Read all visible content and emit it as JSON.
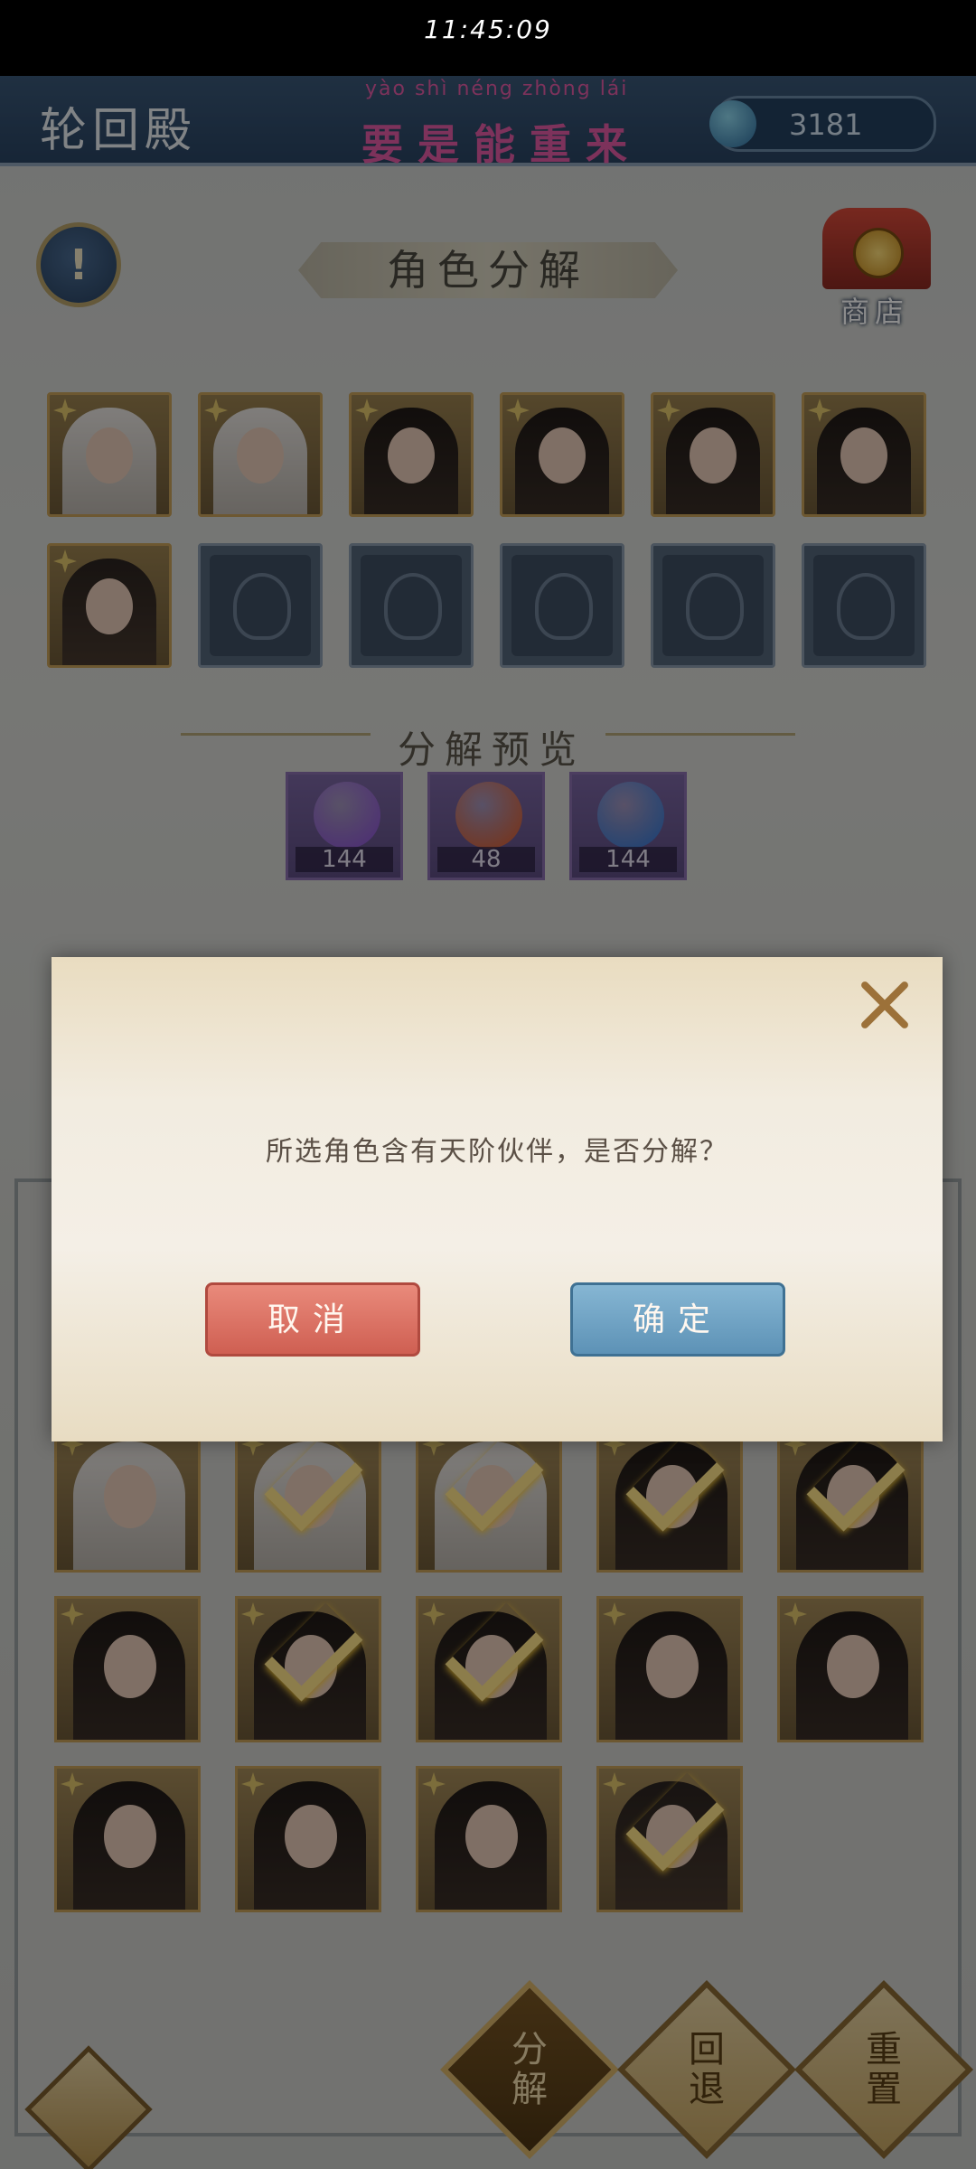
{
  "status_bar": {
    "time": "11:45:09"
  },
  "header": {
    "scene_title": "轮回殿",
    "slogan_pinyin": "yào shì néng zhòng lái",
    "slogan": "要是能重来",
    "currency_value": "3181"
  },
  "section": {
    "title": "角色分解",
    "shop_label": "商店"
  },
  "selected_slots": [
    {
      "type": "character",
      "look": "white"
    },
    {
      "type": "character",
      "look": "white"
    },
    {
      "type": "character",
      "look": "dark"
    },
    {
      "type": "character",
      "look": "dark"
    },
    {
      "type": "character",
      "look": "dark"
    },
    {
      "type": "character",
      "look": "dark"
    },
    {
      "type": "character",
      "look": "man"
    },
    {
      "type": "empty"
    },
    {
      "type": "empty"
    },
    {
      "type": "empty"
    },
    {
      "type": "empty"
    },
    {
      "type": "empty"
    }
  ],
  "preview": {
    "title": "分解预览",
    "items": [
      {
        "name": "purple-essence",
        "count": "144",
        "color": "#8c4fd8"
      },
      {
        "name": "red-essence",
        "count": "48",
        "color": "#e05a24"
      },
      {
        "name": "blue-essence",
        "count": "144",
        "color": "#2e78d8"
      }
    ]
  },
  "inventory": [
    {
      "look": "white",
      "checked": false
    },
    {
      "look": "white",
      "checked": true
    },
    {
      "look": "white",
      "checked": true
    },
    {
      "look": "dark",
      "checked": true
    },
    {
      "look": "dark",
      "checked": true
    },
    {
      "look": "dark",
      "checked": false
    },
    {
      "look": "dark",
      "checked": true
    },
    {
      "look": "dark",
      "checked": true
    },
    {
      "look": "dark",
      "checked": false
    },
    {
      "look": "dark",
      "checked": false
    },
    {
      "look": "dark",
      "checked": false
    },
    {
      "look": "dark",
      "checked": false
    },
    {
      "look": "dark",
      "checked": false
    },
    {
      "look": "man",
      "checked": true
    }
  ],
  "actions": {
    "decompose": [
      "分",
      "解"
    ],
    "rollback": [
      "回",
      "退"
    ],
    "reset": [
      "重",
      "置"
    ]
  },
  "dialog": {
    "message": "所选角色含有天阶伙伴，是否分解？",
    "cancel_label": "取消",
    "confirm_label": "确定"
  }
}
